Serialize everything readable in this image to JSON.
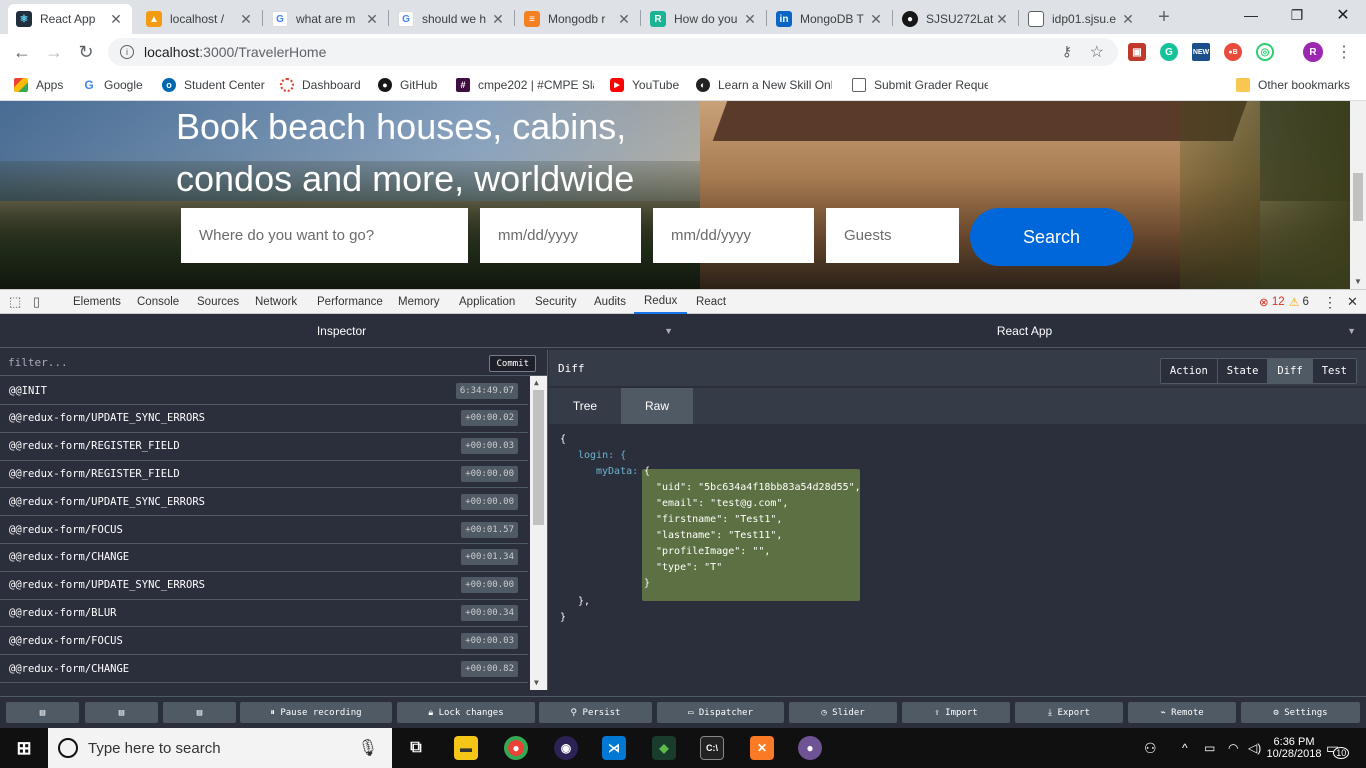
{
  "tabs": [
    {
      "title": "React App",
      "favicon": "react-icon",
      "color": "#222f3e",
      "active": true
    },
    {
      "title": "localhost /",
      "favicon": "xampp-icon",
      "color": "#f39c12"
    },
    {
      "title": "what are m",
      "favicon": "google-icon",
      "color": "#4285f4"
    },
    {
      "title": "should we h",
      "favicon": "google-icon",
      "color": "#4285f4"
    },
    {
      "title": "Mongodb r",
      "favicon": "stack-icon",
      "color": "#f48024"
    },
    {
      "title": "How do you",
      "favicon": "r-icon",
      "color": "#1ab394"
    },
    {
      "title": "MongoDB T",
      "favicon": "linkedin-icon",
      "color": "#0a66c2"
    },
    {
      "title": "SJSU272Lat",
      "favicon": "github-icon",
      "color": "#181717"
    },
    {
      "title": "idp01.sjsu.e",
      "favicon": "document-icon",
      "color": "#5f6368"
    }
  ],
  "toolbar": {
    "url_host": "localhost",
    "url_path": ":3000/TravelerHome",
    "profile_initial": "R"
  },
  "bookmarks": [
    {
      "label": "Apps",
      "icon": "apps-icon",
      "color": "#4285f4"
    },
    {
      "label": "Google",
      "icon": "google-icon",
      "color": "#4285f4"
    },
    {
      "label": "Student Center",
      "icon": "peoplesoft-icon",
      "color": "#0067b1"
    },
    {
      "label": "Dashboard",
      "icon": "canvas-icon",
      "color": "#e13f2b"
    },
    {
      "label": "GitHub",
      "icon": "github-icon",
      "color": "#181717"
    },
    {
      "label": "cmpe202 | #CMPE Sla",
      "icon": "slack-icon",
      "color": "#3f0e40"
    },
    {
      "label": "YouTube",
      "icon": "youtube-icon",
      "color": "#ff0000"
    },
    {
      "label": "Learn a New Skill Onl",
      "icon": "lynda-icon",
      "color": "#222"
    },
    {
      "label": "Submit Grader Reque",
      "icon": "document-icon",
      "color": "#5f6368"
    },
    {
      "label": "Other bookmarks",
      "icon": "folder-icon",
      "color": "#f9c74f"
    }
  ],
  "hero": {
    "title_line1": "Book beach houses, cabins,",
    "title_line2": "condos and more, worldwide",
    "where_placeholder": "Where do you want to go?",
    "checkin_placeholder": "mm/dd/yyyy",
    "checkout_placeholder": "mm/dd/yyyy",
    "guests_placeholder": "Guests",
    "search_label": "Search"
  },
  "devtools": {
    "tabs": [
      "Elements",
      "Console",
      "Sources",
      "Network",
      "Performance",
      "Memory",
      "Application",
      "Security",
      "Audits",
      "Redux",
      "React"
    ],
    "selected_tab": "Redux",
    "errors": "12",
    "warnings": "6"
  },
  "redux": {
    "left_header": "Inspector",
    "right_header": "React App",
    "filter_placeholder": "filter...",
    "commit_label": "Commit",
    "actions": [
      {
        "name": "@@INIT",
        "time": "6:34:49.07"
      },
      {
        "name": "@@redux-form/UPDATE_SYNC_ERRORS",
        "time": "+00:00.02"
      },
      {
        "name": "@@redux-form/REGISTER_FIELD",
        "time": "+00:00.03"
      },
      {
        "name": "@@redux-form/REGISTER_FIELD",
        "time": "+00:00.00"
      },
      {
        "name": "@@redux-form/UPDATE_SYNC_ERRORS",
        "time": "+00:00.00"
      },
      {
        "name": "@@redux-form/FOCUS",
        "time": "+00:01.57"
      },
      {
        "name": "@@redux-form/CHANGE",
        "time": "+00:01.34"
      },
      {
        "name": "@@redux-form/UPDATE_SYNC_ERRORS",
        "time": "+00:00.00"
      },
      {
        "name": "@@redux-form/BLUR",
        "time": "+00:00.34"
      },
      {
        "name": "@@redux-form/FOCUS",
        "time": "+00:00.03"
      },
      {
        "name": "@@redux-form/CHANGE",
        "time": "+00:00.82"
      }
    ],
    "panel_title": "Diff",
    "modes": [
      "Action",
      "State",
      "Diff",
      "Test"
    ],
    "selected_mode": "Diff",
    "subtabs": [
      "Tree",
      "Raw"
    ],
    "selected_subtab": "Raw",
    "diff_lines": {
      "open": "{",
      "login": "login: {",
      "mydata_key": "myData:",
      "obj_open": "{",
      "uid": "\"uid\": \"5bc634a4f18bb83a54d28d55\",",
      "email": "\"email\": \"test@g.com\",",
      "firstname": "\"firstname\": \"Test1\",",
      "lastname": "\"lastname\": \"Test11\",",
      "profileImage": "\"profileImage\": \"\",",
      "type": "\"type\": \"T\"",
      "obj_close": "}",
      "login_close": "},",
      "close": "}"
    },
    "bottom_buttons": [
      "Pause recording",
      "Lock changes",
      "Persist",
      "Dispatcher",
      "Slider",
      "Import",
      "Export",
      "Remote",
      "Settings"
    ]
  },
  "taskbar": {
    "search_placeholder": "Type here to search",
    "time": "6:36 PM",
    "date": "10/28/2018",
    "notifications": "10"
  }
}
